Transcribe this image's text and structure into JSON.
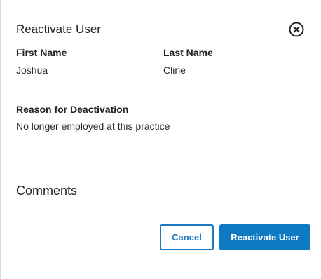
{
  "dialog": {
    "title": "Reactivate User",
    "close_icon": "close-circle-icon"
  },
  "fields": {
    "first_name": {
      "label": "First Name",
      "value": "Joshua"
    },
    "last_name": {
      "label": "Last Name",
      "value": "Cline"
    },
    "reason": {
      "label": "Reason for Deactivation",
      "value": "No longer employed at this practice"
    }
  },
  "comments": {
    "heading": "Comments"
  },
  "actions": {
    "cancel_label": "Cancel",
    "confirm_label": "Reactivate User"
  },
  "colors": {
    "primary": "#0e7ac4",
    "primary_text": "#ffffff",
    "outline": "#1f7bc0"
  }
}
